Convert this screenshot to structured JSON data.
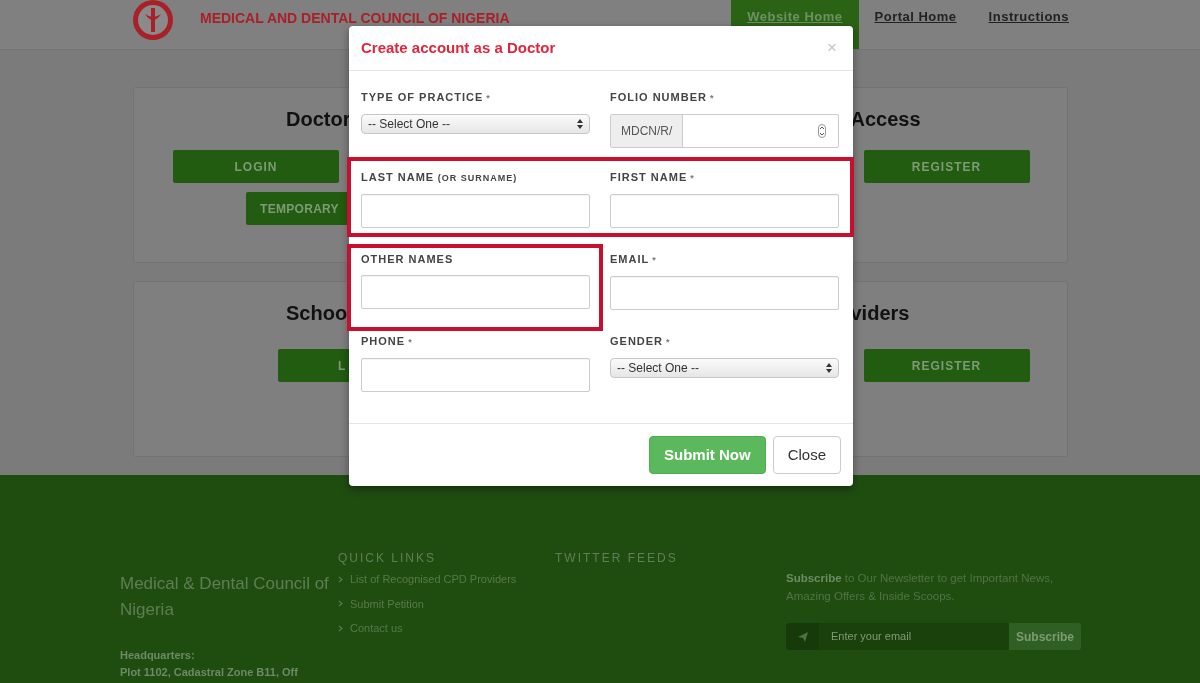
{
  "header": {
    "title": "MEDICAL AND DENTAL COUNCIL OF NIGERIA",
    "nav": [
      {
        "label": "Website Home",
        "selected": true
      },
      {
        "label": "Portal Home",
        "selected": false
      },
      {
        "label": "Instructions",
        "selected": false
      }
    ]
  },
  "cards": [
    {
      "left_heading": "Doctor",
      "right_heading": "Access",
      "left_buttons": [
        "LOGIN",
        "TEMPORARY"
      ],
      "right_buttons": [
        "REGISTER"
      ]
    },
    {
      "left_heading": "Schoo",
      "right_heading": "viders",
      "left_buttons": [
        "L"
      ],
      "right_buttons": [
        "REGISTER"
      ]
    }
  ],
  "modal": {
    "title": "Create account as a Doctor",
    "close_icon": "×",
    "rows": [
      [
        {
          "kind": "select",
          "label": "TYPE OF PRACTICE",
          "mark": "*",
          "value": "-- Select One --",
          "highlighted": false
        },
        {
          "kind": "prefixed",
          "label": "FOLIO NUMBER",
          "mark": "*",
          "prefix": "MDCN/R/",
          "highlighted": false
        }
      ],
      [
        {
          "kind": "text",
          "label": "LAST NAME",
          "note": "(OR SURNAME)",
          "highlighted": true
        },
        {
          "kind": "text",
          "label": "FIRST NAME",
          "mark": "*",
          "highlighted": true
        }
      ],
      [
        {
          "kind": "text",
          "label": "OTHER NAMES",
          "highlighted": true
        },
        {
          "kind": "text",
          "label": "EMAIL",
          "mark": "*",
          "highlighted": false
        }
      ],
      [
        {
          "kind": "text",
          "label": "PHONE",
          "mark": "*",
          "highlighted": false
        },
        {
          "kind": "select",
          "label": "GENDER",
          "mark": "*",
          "value": "-- Select One --",
          "highlighted": false
        }
      ]
    ],
    "buttons": [
      {
        "label": "Submit Now",
        "kind": "primary"
      },
      {
        "label": "Close",
        "kind": "default"
      }
    ]
  },
  "footer": {
    "org_name": "Medical & Dental Council of Nigeria",
    "hq_label": "Headquarters:",
    "hq_address": "Plot 1102, Cadastral Zone B11, Off",
    "quick_links_title": "QUICK LINKS",
    "quick_links": [
      "List of Recognised CPD Providers",
      "Submit Petition",
      "Contact us"
    ],
    "twitter_title": "TWITTER FEEDS",
    "newsletter_text": "**Subscribe** to Our Newsletter to get Important News, Amazing Offers & Inside Scoops.",
    "email_placeholder": "Enter your email",
    "subscribe_button": "Subscribe"
  }
}
